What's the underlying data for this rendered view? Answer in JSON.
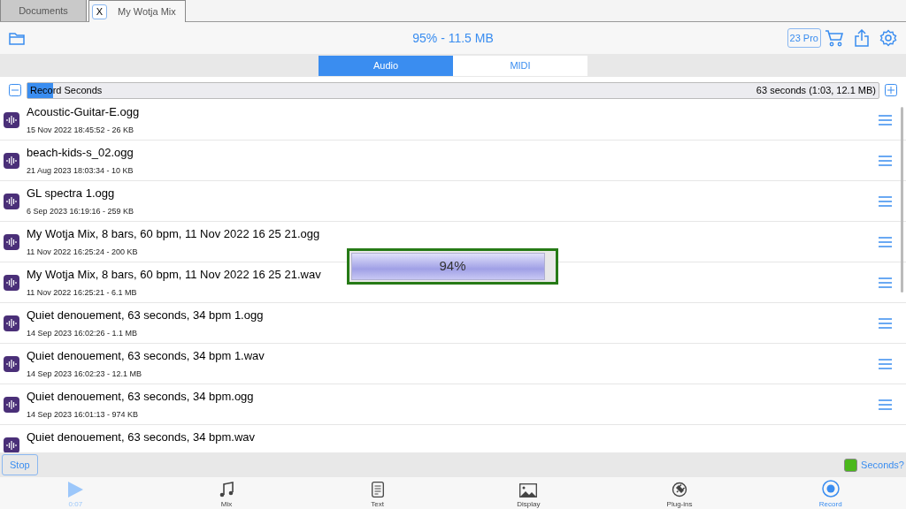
{
  "doc_tabs": [
    {
      "label": "Documents",
      "selected": false,
      "closable": false
    },
    {
      "label": "My Wotja Mix",
      "selected": true,
      "closable": true
    }
  ],
  "close_label": "X",
  "toolbar": {
    "title": "95% - 11.5 MB",
    "badge": "23 Pro"
  },
  "segments": [
    {
      "label": "Audio",
      "selected": true
    },
    {
      "label": "MIDI",
      "selected": false
    }
  ],
  "record": {
    "label": "Record Seconds",
    "level": 0.03,
    "reading": "63 seconds (1:03, 12.1 MB)"
  },
  "files": [
    {
      "name": "Acoustic-Guitar-E.ogg",
      "meta": "15 Nov 2022 18:45:52 - 26 KB"
    },
    {
      "name": "beach-kids-s_02.ogg",
      "meta": "21 Aug 2023 18:03:34 - 10 KB"
    },
    {
      "name": "GL spectra 1.ogg",
      "meta": "6 Sep 2023 16:19:16 - 259 KB"
    },
    {
      "name": "My Wotja Mix, 8 bars, 60 bpm, 11 Nov 2022 16 25 21.ogg",
      "meta": "11 Nov 2022 16:25:24 - 200 KB"
    },
    {
      "name": "My Wotja Mix, 8 bars, 60 bpm, 11 Nov 2022 16 25 21.wav",
      "meta": "11 Nov 2022 16:25:21 - 6.1 MB"
    },
    {
      "name": "Quiet denouement, 63 seconds, 34 bpm 1.ogg",
      "meta": "14 Sep 2023 16:02:26 - 1.1 MB"
    },
    {
      "name": "Quiet denouement, 63 seconds, 34 bpm 1.wav",
      "meta": "14 Sep 2023 16:02:23 - 12.1 MB"
    },
    {
      "name": "Quiet denouement, 63 seconds, 34 bpm.ogg",
      "meta": "14 Sep 2023 16:01:13 - 974 KB"
    },
    {
      "name": "Quiet denouement, 63 seconds, 34 bpm.wav"
    }
  ],
  "progress": {
    "level": 0.94,
    "label": "94%"
  },
  "stop_label": "Stop",
  "seconds": {
    "label": "Seconds?",
    "checked": true
  },
  "bottom_tabs": [
    {
      "kind": "play",
      "label": "0:07",
      "selected": false
    },
    {
      "kind": "mix",
      "label": "Mix",
      "selected": false
    },
    {
      "kind": "text",
      "label": "Text",
      "selected": false
    },
    {
      "kind": "display",
      "label": "Display",
      "selected": false
    },
    {
      "kind": "plugins",
      "label": "Plug-ins",
      "selected": false
    },
    {
      "kind": "record",
      "label": "Record",
      "selected": true
    }
  ]
}
